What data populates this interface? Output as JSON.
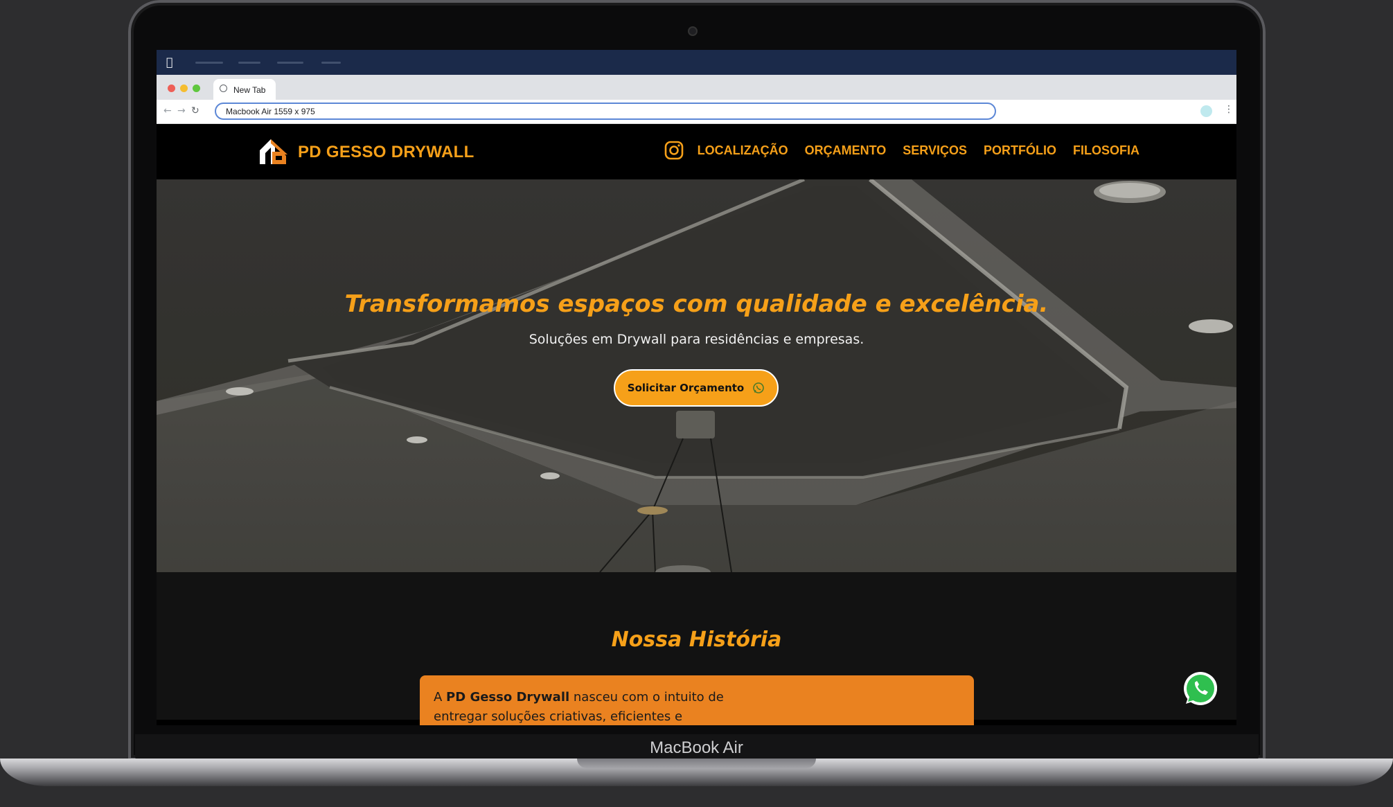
{
  "device": {
    "label": "MacBook Air"
  },
  "browser": {
    "tab_title": "New Tab",
    "address": "Macbook Air   1559 x 975",
    "traffic_lights": [
      "#ee5f57",
      "#f5bd2f",
      "#5fc73e"
    ]
  },
  "site": {
    "brand": "PD GESSO DRYWALL",
    "nav": [
      "LOCALIZAÇÃO",
      "ORÇAMENTO",
      "SERVIÇOS",
      "PORTFÓLIO",
      "FILOSOFIA"
    ],
    "hero": {
      "title": "Transformamos espaços com qualidade e excelência.",
      "subtitle": "Soluções em Drywall para residências e empresas.",
      "cta": "Solicitar Orçamento"
    },
    "history": {
      "title": "Nossa História",
      "text_prefix": "A ",
      "text_bold": "PD Gesso Drywall",
      "text_rest": " nasceu com o intuito de",
      "text_line2": "entregar soluções criativas, eficientes e"
    }
  },
  "colors": {
    "accent": "#f6a019",
    "card": "#ea8220",
    "menubar": "#1b2a4a"
  },
  "icons": [
    "apple-icon",
    "globe-icon",
    "instagram-icon",
    "whatsapp-icon"
  ]
}
